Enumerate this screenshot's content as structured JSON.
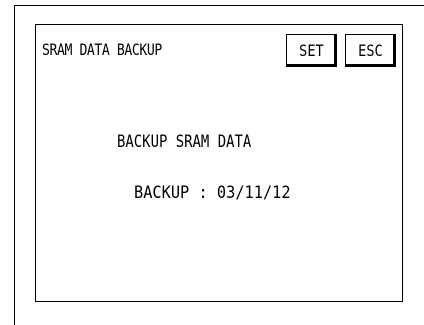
{
  "screen": {
    "title": "SRAM DATA BACKUP",
    "buttons": {
      "set_label": "SET",
      "esc_label": "ESC"
    },
    "heading": "BACKUP SRAM DATA",
    "backup_status": "BACKUP : 03/11/12"
  }
}
